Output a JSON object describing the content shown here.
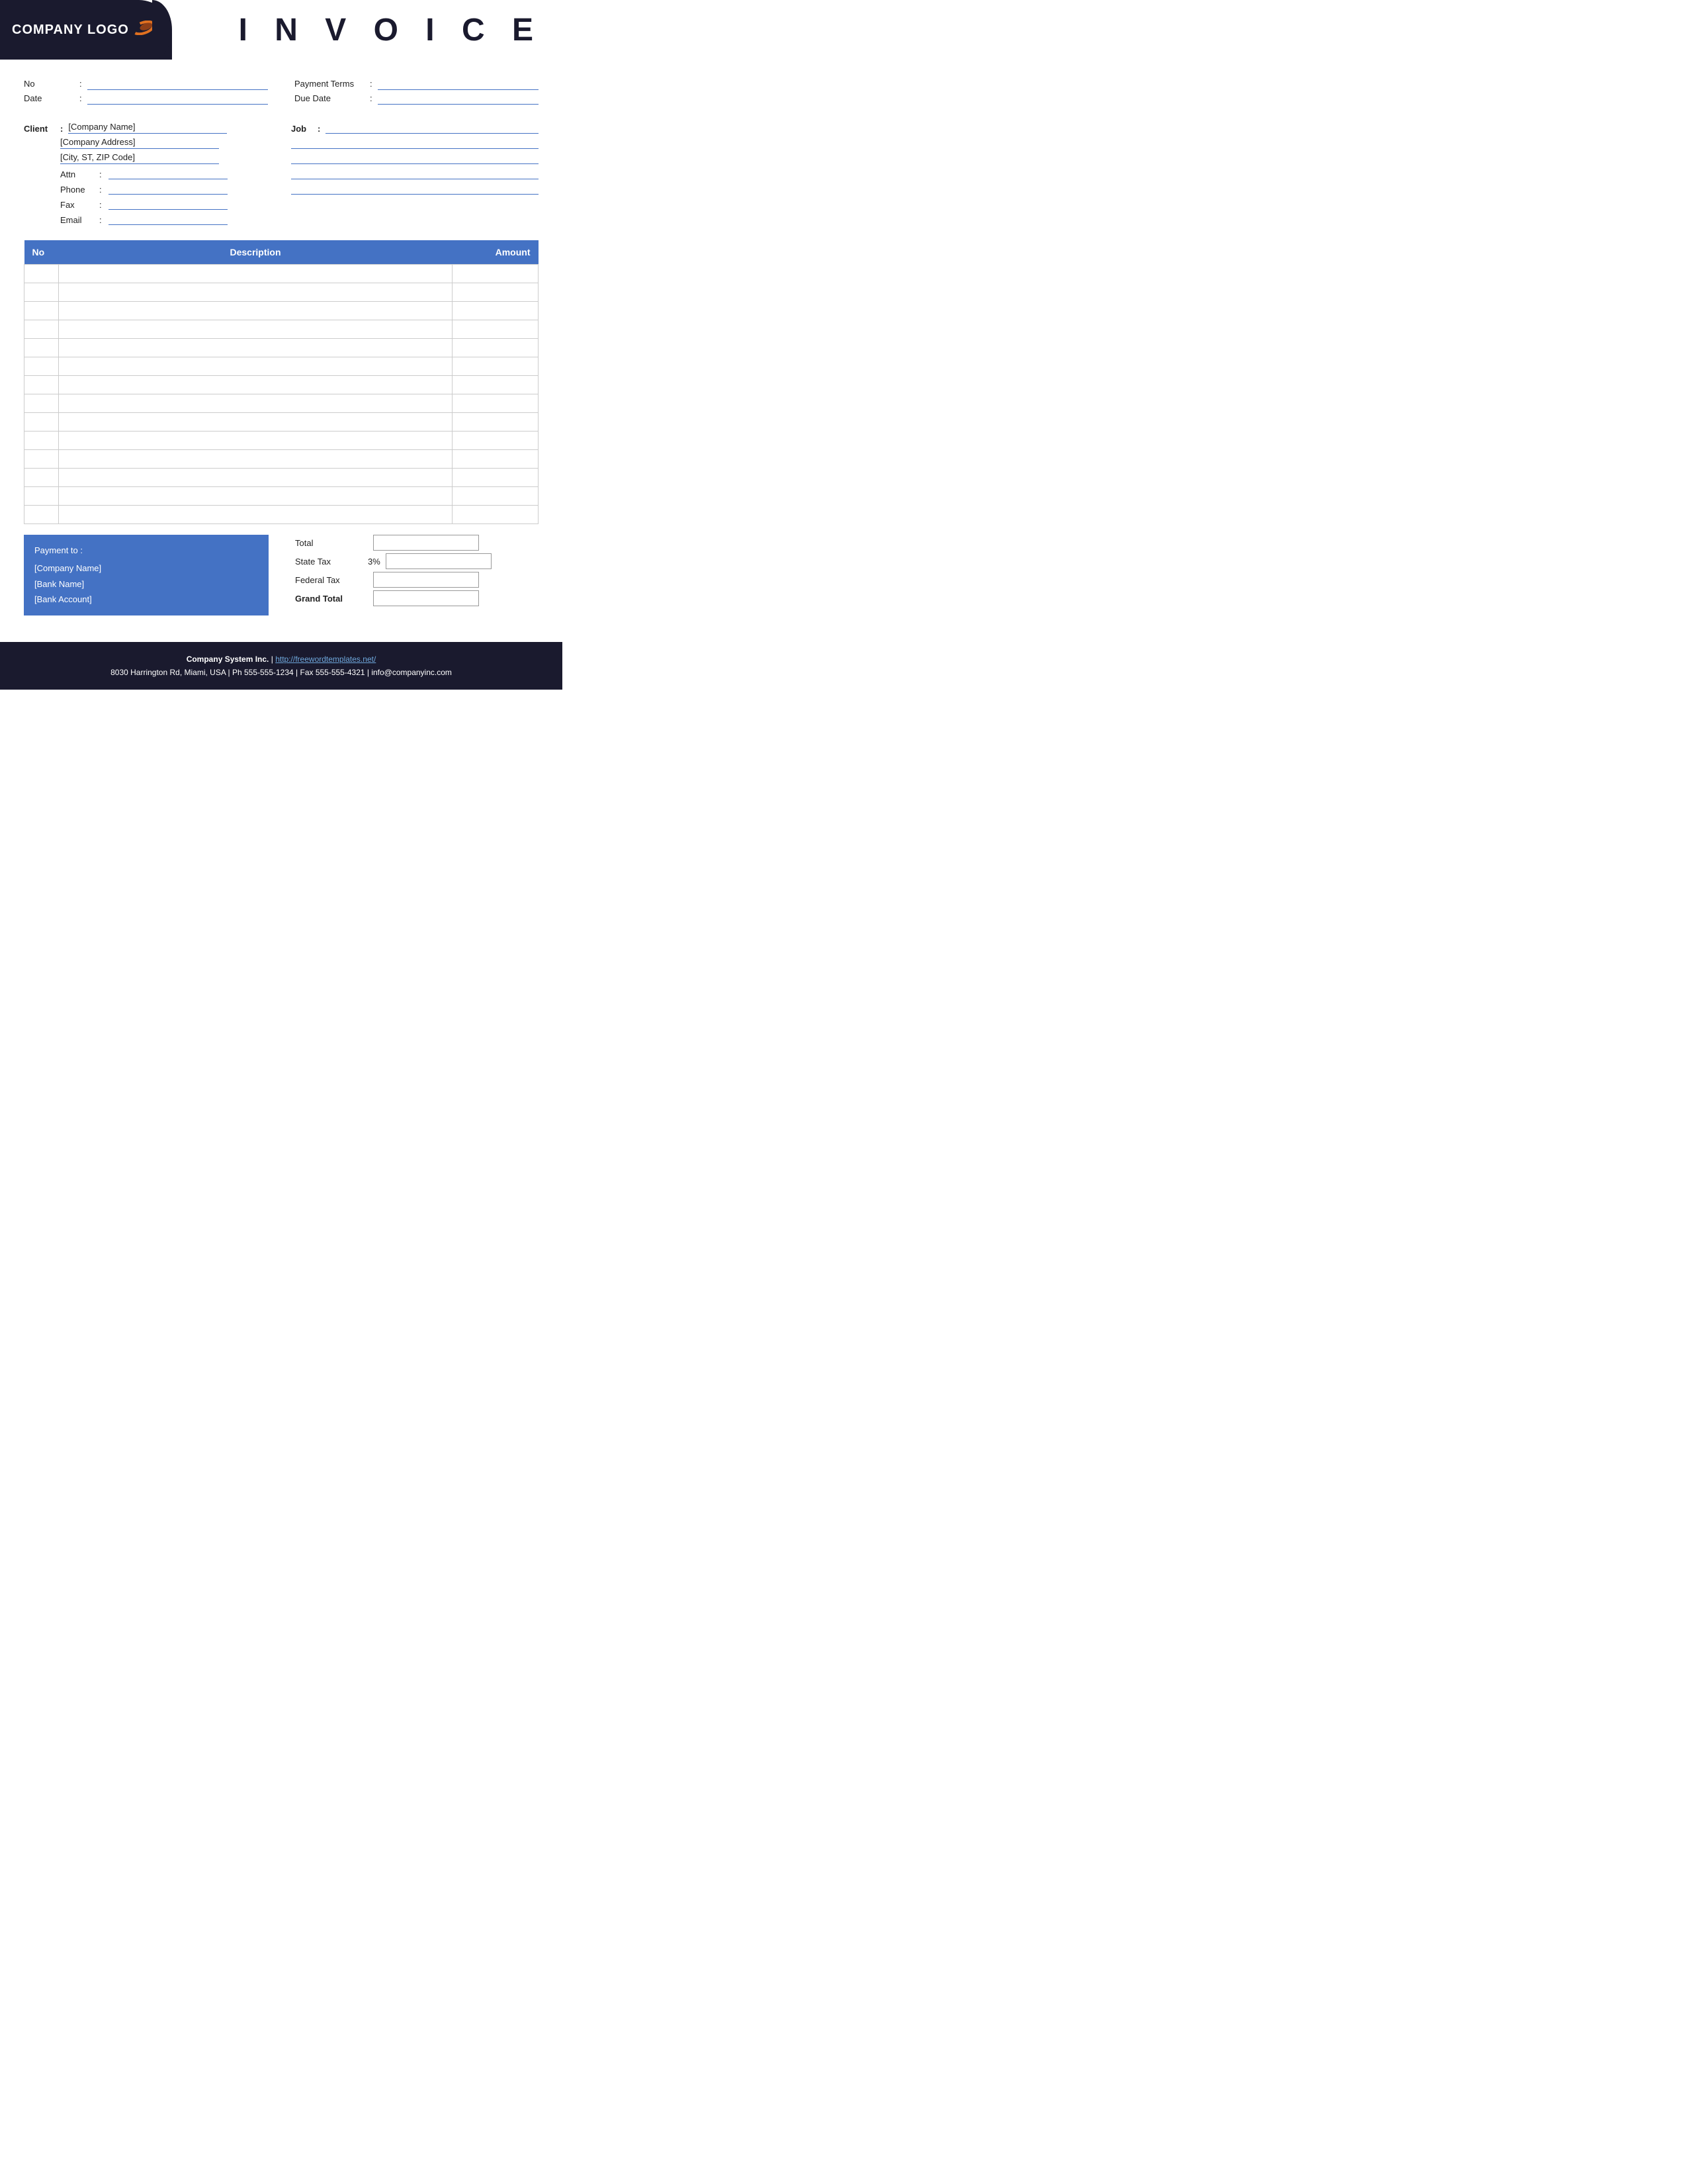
{
  "header": {
    "logo_text": "COMPANY LOGO",
    "title": "I N V O I C E"
  },
  "top_fields": {
    "left": [
      {
        "label": "No",
        "colon": ":"
      },
      {
        "label": "Date",
        "colon": ":"
      }
    ],
    "right": [
      {
        "label": "Payment  Terms",
        "colon": ":"
      },
      {
        "label": "Due Date",
        "colon": ":"
      }
    ]
  },
  "client": {
    "label": "Client",
    "colon": ":",
    "company_name": "[Company Name]",
    "company_address": "[Company Address]",
    "city_zip": "[City, ST, ZIP Code]",
    "fields": [
      {
        "label": "Attn",
        "colon": ":"
      },
      {
        "label": "Phone",
        "colon": ":"
      },
      {
        "label": "Fax",
        "colon": ":"
      },
      {
        "label": "Email",
        "colon": ":"
      }
    ]
  },
  "job": {
    "label": "Job",
    "colon": ":"
  },
  "table": {
    "headers": [
      "No",
      "Description",
      "Amount"
    ],
    "rows": 14
  },
  "payment": {
    "title": "Payment to :",
    "company": "[Company Name]",
    "bank": "[Bank Name]",
    "account": "[Bank Account]"
  },
  "totals": [
    {
      "label": "Total",
      "tax_pct": ""
    },
    {
      "label": "State Tax",
      "tax_pct": "3%"
    },
    {
      "label": "Federal Tax",
      "tax_pct": ""
    },
    {
      "label": "Grand Total",
      "tax_pct": "",
      "bold": true
    }
  ],
  "footer": {
    "company": "Company System Inc.",
    "separator": "|",
    "website": "http://freewordtemplates.net/",
    "address": "8030 Harrington Rd, Miami, USA | Ph 555-555-1234 | Fax 555-555-4321 | info@companyinc.com"
  }
}
